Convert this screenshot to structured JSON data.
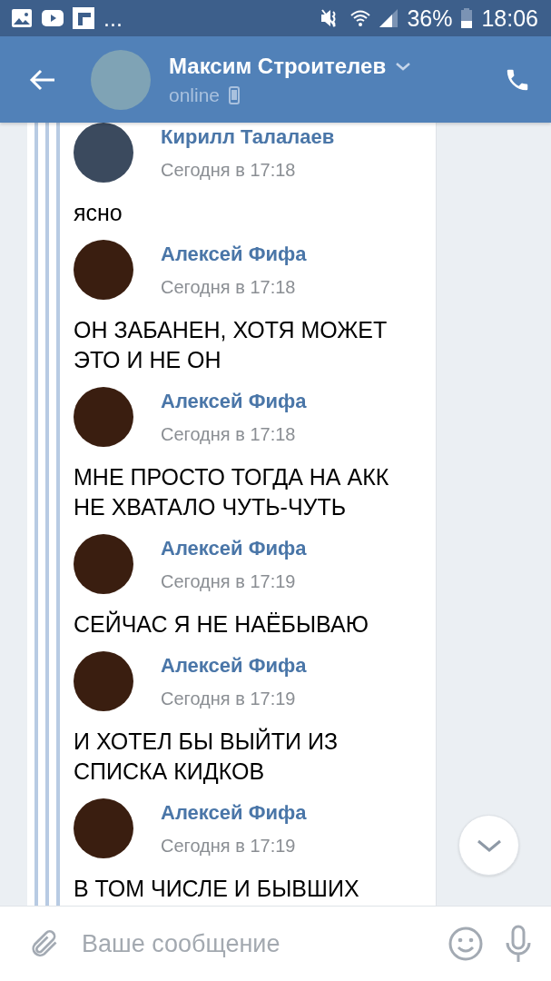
{
  "status_bar": {
    "more": "...",
    "battery": "36%",
    "time": "18:06"
  },
  "header": {
    "title": "Максим Строителев",
    "status": "online"
  },
  "messages": [
    {
      "author": "Кирилл Талалаев",
      "time": "Сегодня в 17:18",
      "text": "ясно"
    },
    {
      "author": "Алексей Фифа",
      "time": "Сегодня в 17:18",
      "text": "ОН ЗАБАНЕН, ХОТЯ МОЖЕТ ЭТО И НЕ ОН"
    },
    {
      "author": "Алексей Фифа",
      "time": "Сегодня в 17:18",
      "text": "МНЕ ПРОСТО ТОГДА НА АКК НЕ ХВАТАЛО ЧУТЬ-ЧУТЬ"
    },
    {
      "author": "Алексей Фифа",
      "time": "Сегодня в 17:19",
      "text": "СЕЙЧАС Я НЕ НАЁБЫВАЮ"
    },
    {
      "author": "Алексей Фифа",
      "time": "Сегодня в 17:19",
      "text": "И ХОТЕЛ БЫ ВЫЙТИ ИЗ СПИСКА КИДКОВ"
    },
    {
      "author": "Алексей Фифа",
      "time": "Сегодня в 17:19",
      "text": "В ТОМ ЧИСЛЕ И БЫВШИХ"
    }
  ],
  "composer": {
    "placeholder": "Ваше сообщение"
  }
}
